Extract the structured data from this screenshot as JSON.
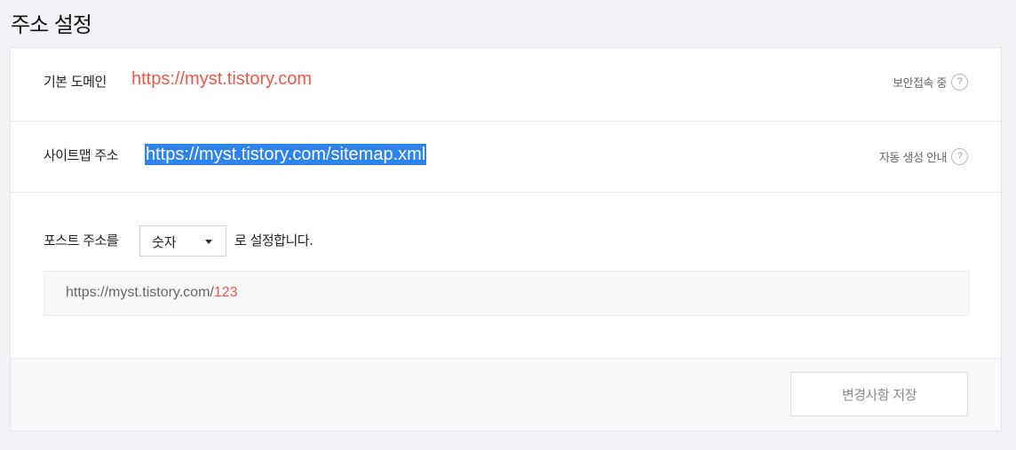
{
  "page": {
    "title": "주소 설정"
  },
  "domain": {
    "label": "기본 도메인",
    "value": "https://myst.tistory.com",
    "note": "보안접속 중",
    "help": "?"
  },
  "sitemap": {
    "label": "사이트맵 주소",
    "value": "https://myst.tistory.com/sitemap.xml",
    "note": "자동 생성 안내",
    "help": "?"
  },
  "post_address": {
    "label": "포스트 주소를",
    "selected": "숫자",
    "suffix": "로 설정합니다.",
    "preview_base": "https://myst.tistory.com/",
    "preview_num": "123"
  },
  "footer": {
    "save_label": "변경사항 저장"
  }
}
